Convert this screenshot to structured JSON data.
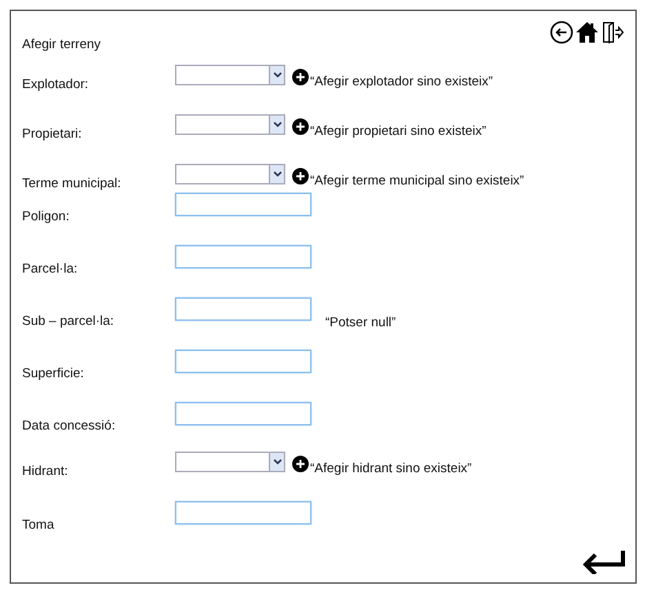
{
  "window": {
    "title": "Afegir terreny"
  },
  "fields": [
    {
      "label": "Explotador:",
      "kind": "select",
      "note": "“Afegir explotador sino existeix”",
      "add_button": true
    },
    {
      "label": "Propietari:",
      "kind": "select",
      "note": "“Afegir propietari sino existeix”",
      "add_button": true
    },
    {
      "label": "Terme municipal:",
      "kind": "select",
      "note": "“Afegir terme municipal sino existeix”",
      "add_button": true
    },
    {
      "label": "Poligon:",
      "kind": "text"
    },
    {
      "label": "Parcel·la:",
      "kind": "text"
    },
    {
      "label": "Sub – parcel·la:",
      "kind": "text",
      "note": "“Potser null”"
    },
    {
      "label": "Superficie:",
      "kind": "text"
    },
    {
      "label": "Data concessió:",
      "kind": "text"
    },
    {
      "label": "Hidrant:",
      "kind": "select",
      "note": "“Afegir hidrant sino existeix”",
      "add_button": true
    },
    {
      "label": "Toma",
      "kind": "text"
    }
  ]
}
